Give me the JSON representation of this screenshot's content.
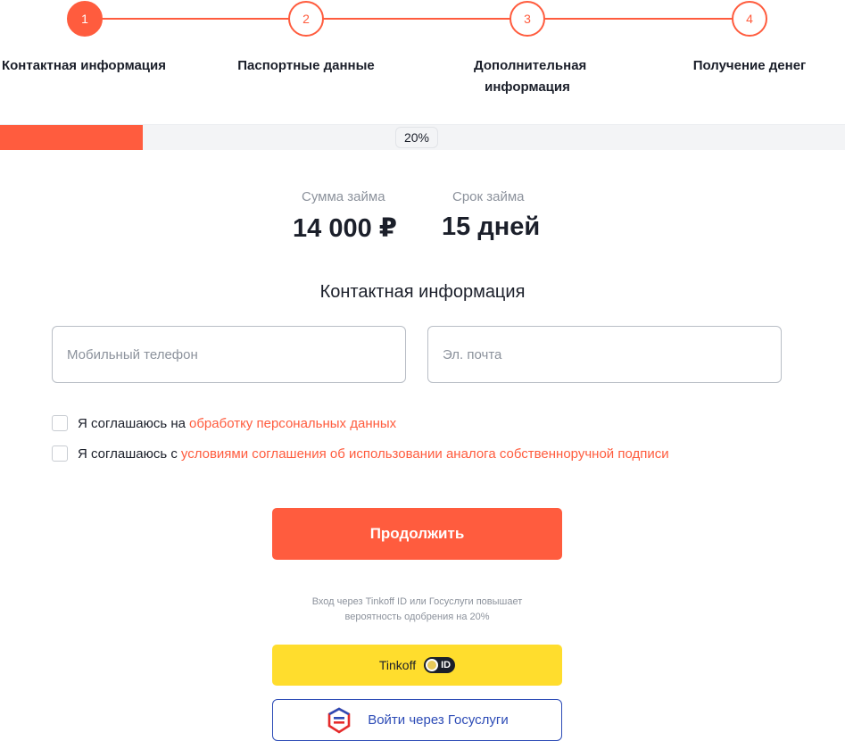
{
  "stepper": {
    "steps": [
      {
        "number": "1",
        "label": "Контактная информация"
      },
      {
        "number": "2",
        "label": "Паспортные данные"
      },
      {
        "number": "3",
        "label": "Дополнительная информация"
      },
      {
        "number": "4",
        "label": "Получение денег"
      }
    ],
    "active_step": 1
  },
  "progress": {
    "value": 0.2,
    "label": "20%"
  },
  "loan": {
    "amount_label": "Сумма займа",
    "amount_value": "14 000 ₽",
    "term_label": "Срок займа",
    "term_value": "15 дней"
  },
  "form": {
    "title": "Контактная информация",
    "phone_placeholder": "Мобильный телефон",
    "email_placeholder": "Эл. почта",
    "consent1_text": "Я соглашаюсь на",
    "consent1_link": "обработку персональных данных",
    "consent2_text": "Я соглашаюсь с",
    "consent2_link": "условиями соглашения об использовании аналога собственноручной подписи",
    "continue_label": "Продолжить",
    "hint": "Вход через Tinkoff ID или Госуслуги повышает вероятность одобрения на 20%",
    "tinkoff_label": "Tinkoff",
    "tinkoff_badge": "ID",
    "gos_label": "Войти через Госуслуги"
  },
  "colors": {
    "accent": "#ff5c3e",
    "tinkoff_yellow": "#ffdd2d",
    "gos_blue": "#2c4bb6",
    "muted_text": "#8c929c"
  },
  "icons": {
    "tinkoff": "tinkoff-id-icon",
    "gosuslugi": "gosuslugi-icon"
  }
}
